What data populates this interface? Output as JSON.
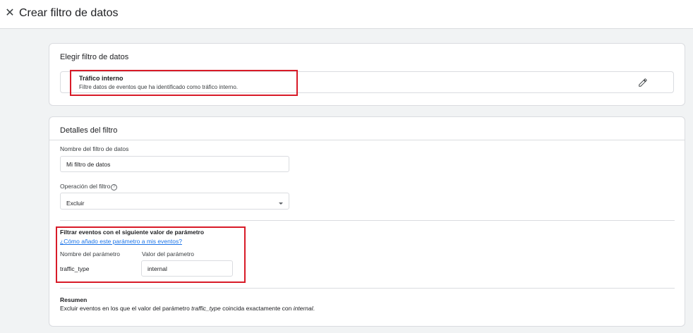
{
  "header": {
    "title": "Crear filtro de datos",
    "close_icon": "close-icon"
  },
  "choose_card": {
    "title": "Elegir filtro de datos",
    "option": {
      "title": "Tráfico interno",
      "description": "Filtre datos de eventos que ha identificado como tráfico interno.",
      "edit_icon": "pencil-icon"
    }
  },
  "details_card": {
    "title": "Detalles del filtro",
    "name_field": {
      "label": "Nombre del filtro de datos",
      "value": "Mi filtro de datos"
    },
    "operation_field": {
      "label": "Operación del filtro",
      "help_icon": "help-icon",
      "value": "Excluir"
    },
    "parameter_section": {
      "title": "Filtrar eventos con el siguiente valor de parámetro",
      "help_link": "¿Cómo añado este parámetro a mis eventos?",
      "col_name_header": "Nombre del parámetro",
      "col_value_header": "Valor del parámetro",
      "param_name": "traffic_type",
      "param_value": "internal"
    },
    "summary": {
      "title": "Resumen",
      "text_before": "Excluir eventos en los que el valor del parámetro ",
      "param": "traffic_type",
      "text_middle": " coincida exactamente con ",
      "value": "internal",
      "text_after": "."
    }
  },
  "colors": {
    "highlight": "#d81b28",
    "link": "#1a73e8",
    "background": "#f1f3f4"
  }
}
